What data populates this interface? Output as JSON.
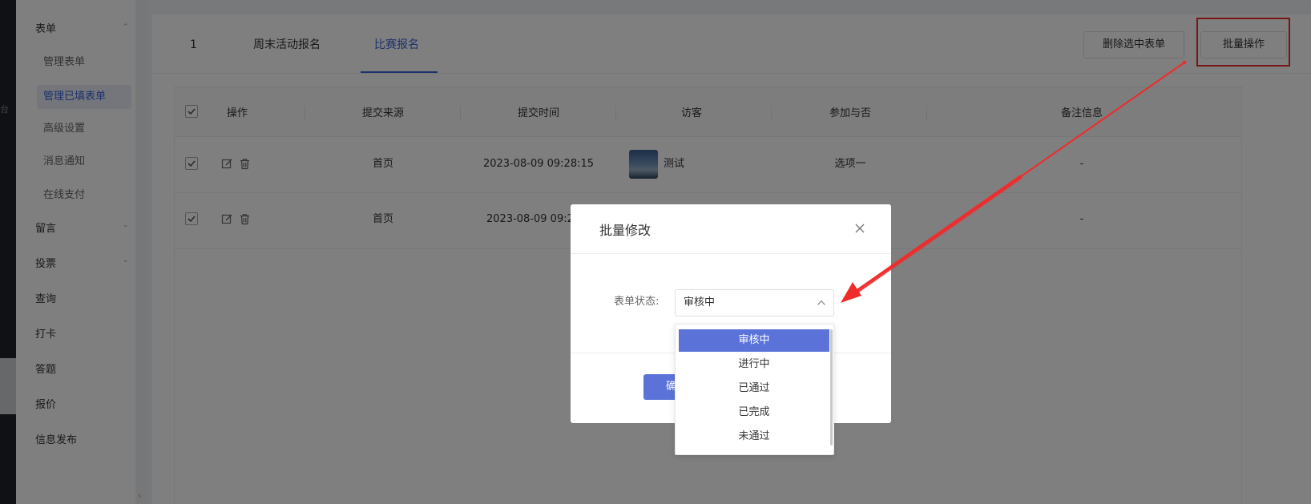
{
  "left_rail": {
    "glyph": "台"
  },
  "sidebar": {
    "form_group": "表单",
    "form_sub": [
      "管理表单",
      "管理已填表单",
      "高级设置",
      "消息通知",
      "在线支付"
    ],
    "groups": [
      "留言",
      "投票",
      "查询",
      "打卡",
      "答题",
      "报价",
      "信息发布"
    ],
    "caret": "⌃",
    "caret_down": "⌄"
  },
  "tabs": [
    {
      "label": "1"
    },
    {
      "label": "周末活动报名"
    },
    {
      "label": "比赛报名"
    }
  ],
  "toolbar": {
    "delete_selected": "删除选中表单",
    "batch_operation": "批量操作"
  },
  "table": {
    "headers": [
      "操作",
      "提交来源",
      "提交时间",
      "访客",
      "参加与否",
      "备注信息"
    ],
    "rows": [
      {
        "source": "首页",
        "time": "2023-08-09 09:28:15",
        "visitor": "测试",
        "join": "选项一",
        "note": "-"
      },
      {
        "source": "首页",
        "time": "2023-08-09 09:2",
        "visitor": "",
        "join": "",
        "note": "-"
      }
    ]
  },
  "dialog": {
    "title": "批量修改",
    "field_label": "表单状态:",
    "selected_value": "审核中",
    "confirm_label": "确",
    "options": [
      "审核中",
      "进行中",
      "已通过",
      "已完成",
      "未通过"
    ]
  },
  "collapse_arrow": "‹",
  "colors": {
    "accent": "#3d63d6",
    "primary_button": "#5b73d9",
    "annotation_red": "#f02b2b"
  }
}
